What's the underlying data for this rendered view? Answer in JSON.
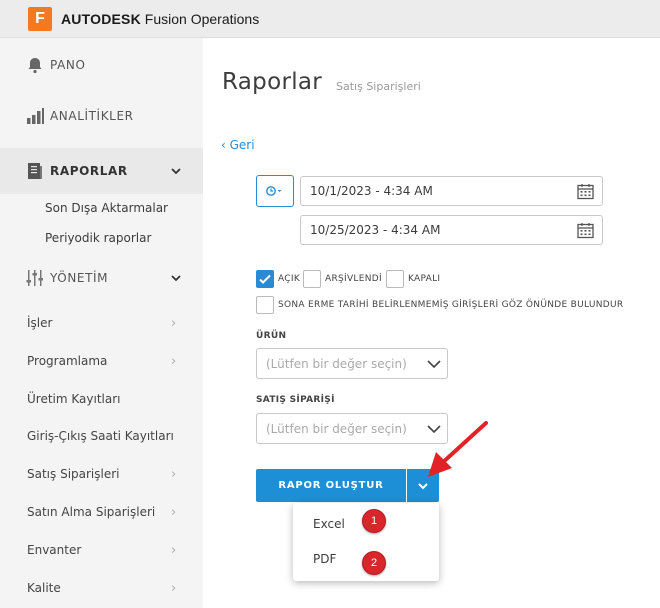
{
  "app": {
    "logo_letter": "F",
    "brand_bold": "AUTODESK",
    "brand_rest": " Fusion Operations",
    "brand_color": "#f47920"
  },
  "sidebar": {
    "items": [
      {
        "label": "PANO",
        "icon": "bell-icon"
      },
      {
        "label": "ANALİTİKLER",
        "icon": "bar-chart-icon"
      },
      {
        "label": "RAPORLAR",
        "icon": "report-icon",
        "active": true,
        "expanded": true
      },
      {
        "label": "YÖNETİM",
        "icon": "sliders-icon",
        "expanded": true
      }
    ],
    "reports_sub": [
      "Son Dışa Aktarmalar",
      "Periyodik raporlar"
    ],
    "management_sub": [
      "İşler",
      "Programlama",
      "Üretim Kayıtları",
      "Giriş-Çıkış Saati Kayıtları",
      "Satış Siparişleri",
      "Satın Alma Siparişleri",
      "Envanter",
      "Kalite"
    ]
  },
  "main": {
    "title": "Raporlar",
    "subtitle": "Satış Siparişleri",
    "back": "‹ Geri",
    "date_from": "10/1/2023 - 4:34 AM",
    "date_to": "10/25/2023 - 4:34 AM",
    "status_filters": [
      {
        "label": "AÇIK",
        "checked": true
      },
      {
        "label": "ARŞİVLENDİ",
        "checked": false
      },
      {
        "label": "KAPALI",
        "checked": false
      }
    ],
    "ignore_label": "SONA ERME TARİHİ BELİRLENMEMİŞ GİRİŞLERİ GÖZ ÖNÜNDE BULUNDUR",
    "product_label": "ÜRÜN",
    "product_placeholder": "(Lütfen bir değer seçin)",
    "order_label": "SATIŞ SİPARİŞİ",
    "order_placeholder": "(Lütfen bir değer seçin)",
    "generate_button": "RAPOR OLUŞTUR",
    "menu": [
      {
        "label": "Excel",
        "badge": "1"
      },
      {
        "label": "PDF",
        "badge": "2"
      }
    ],
    "accent": "#1d8fd6",
    "annotation_color": "#e32227"
  }
}
